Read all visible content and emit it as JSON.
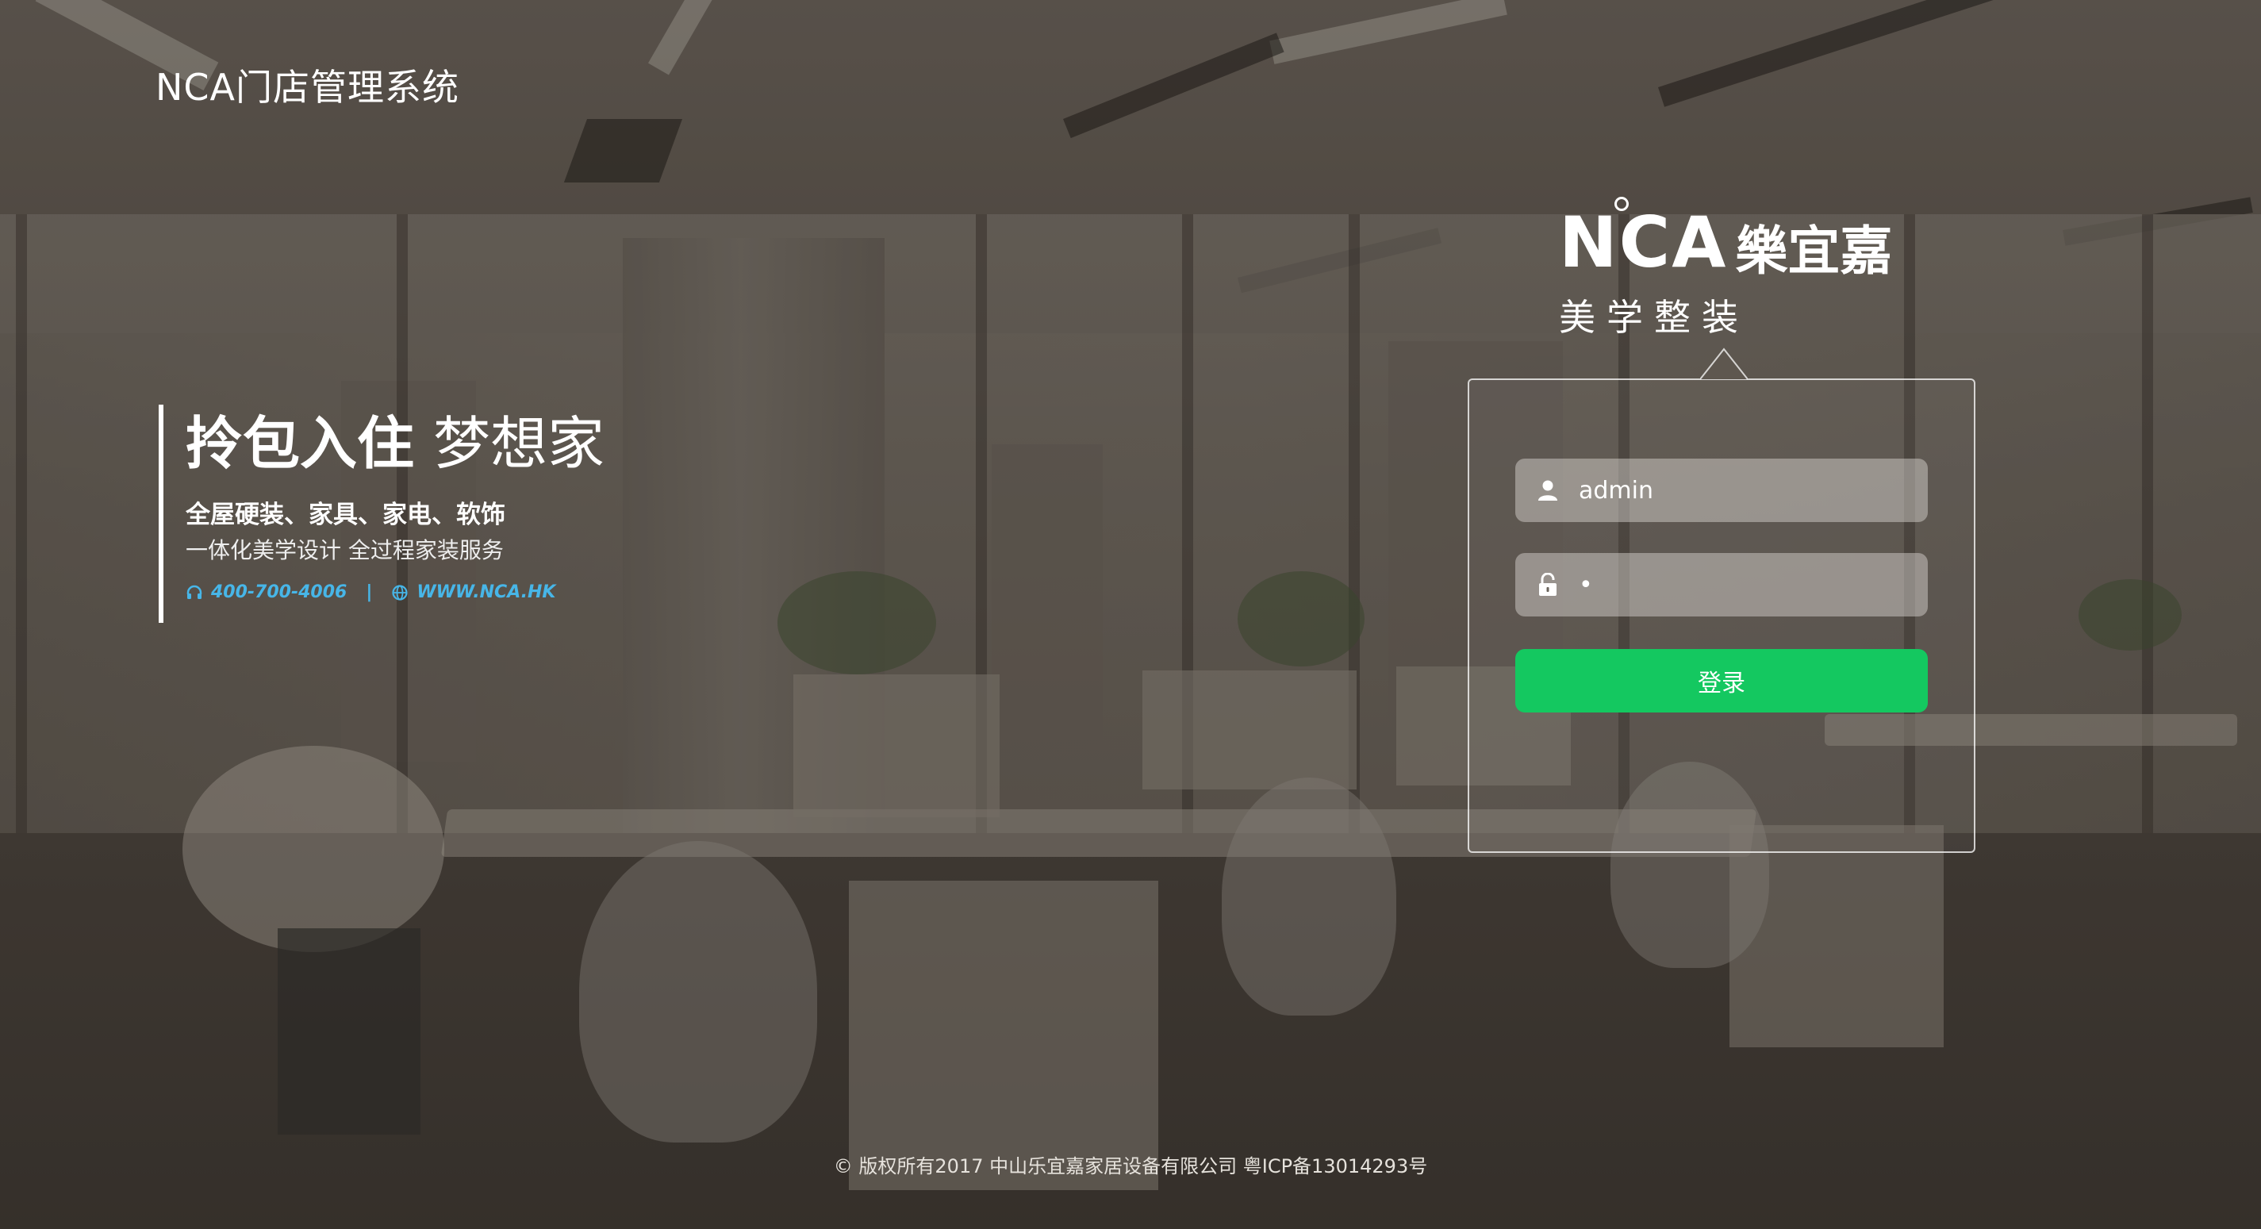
{
  "header": {
    "app_title": "NCA门店管理系统"
  },
  "slogan": {
    "main_bold": "拎包入住",
    "main_light": "梦想家",
    "sub1": "全屋硬装、家具、家电、软饰",
    "sub2": "一体化美学设计 全过程家装服务",
    "phone": "400-700-4006",
    "separator": "|",
    "website": "WWW.NCA.HK",
    "accent_color": "#47b6e8"
  },
  "brand": {
    "logo_text": "NCA",
    "logo_cn": "樂宜嘉",
    "tagline": "美学整装"
  },
  "login": {
    "username_value": "admin",
    "password_value": "•",
    "button_label": "登录",
    "button_color": "#14c860",
    "icons": {
      "user": "user-icon",
      "lock": "lock-icon"
    }
  },
  "footer": {
    "copyright": "© 版权所有2017 中山乐宜嘉家居设备有限公司 粤ICP备13014293号"
  }
}
